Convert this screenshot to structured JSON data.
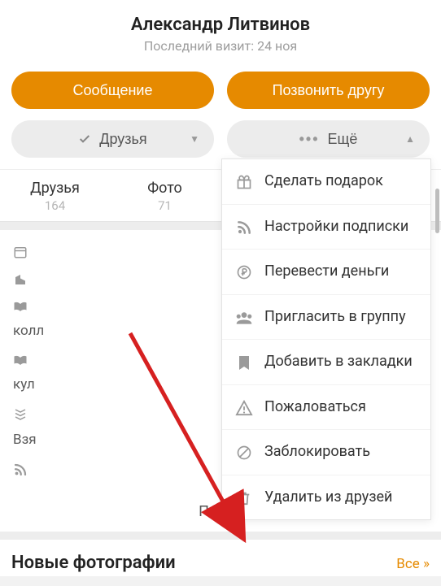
{
  "profile": {
    "name": "Александр Литвинов",
    "visit": "Последний визит: 24 ноя"
  },
  "actions": {
    "message": "Сообщение",
    "call": "Позвонить другу",
    "friends_btn": "Друзья",
    "more_btn": "Ещё"
  },
  "tabs": {
    "friends": {
      "label": "Друзья",
      "count": "164"
    },
    "photos": {
      "label": "Фото",
      "count": "71"
    }
  },
  "info_truncated": {
    "r1": "колл",
    "r2": "кул",
    "r3": "Взя"
  },
  "more_link": "Подро",
  "section": {
    "photos_title": "Новые фотографии",
    "all_link": "Все »"
  },
  "menu": {
    "gift": "Сделать подарок",
    "subscribe": "Настройки подписки",
    "money": "Перевести деньги",
    "invite": "Пригласить в группу",
    "bookmark": "Добавить в закладки",
    "report": "Пожаловаться",
    "block": "Заблокировать",
    "unfriend": "Удалить из друзей"
  }
}
